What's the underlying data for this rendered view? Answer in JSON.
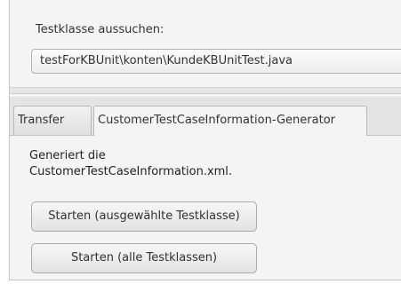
{
  "selector": {
    "label": "Testklasse aussuchen:",
    "selected_value": "testForKBUnit\\konten\\KundeKBUnitTest.java",
    "arrow_icon": "chevron-down-icon"
  },
  "tabs": [
    {
      "label": "Transfer",
      "active": false
    },
    {
      "label": "CustomerTestCaseInformation-Generator",
      "active": true
    }
  ],
  "panel": {
    "description_line1": "Generiert die",
    "description_line2": "CustomerTestCaseInformation.xml.",
    "button_selected": "Starten (ausgewählte Testklasse)",
    "button_all": "Starten (alle Testklassen)"
  }
}
